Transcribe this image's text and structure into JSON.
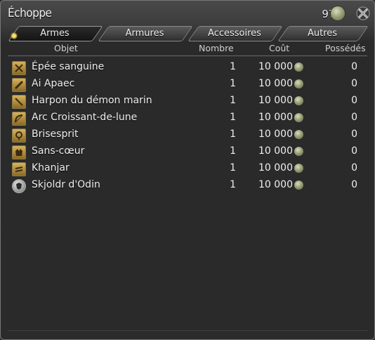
{
  "window": {
    "title": "Échoppe",
    "currency_amount": "970"
  },
  "tabs": [
    {
      "label": "Armes",
      "active": true
    },
    {
      "label": "Armures",
      "active": false
    },
    {
      "label": "Accessoires",
      "active": false
    },
    {
      "label": "Autres",
      "active": false
    }
  ],
  "columns": {
    "item": "Objet",
    "quantity": "Nombre",
    "cost": "Coût",
    "owned": "Possédés"
  },
  "items": [
    {
      "name": "Épée sanguine",
      "quantity": "1",
      "cost": "10 000",
      "owned": "0",
      "icon": "sword-icon"
    },
    {
      "name": "Ai Apaec",
      "quantity": "1",
      "cost": "10 000",
      "owned": "0",
      "icon": "knuckles-icon"
    },
    {
      "name": "Harpon du démon marin",
      "quantity": "1",
      "cost": "10 000",
      "owned": "0",
      "icon": "lance-icon"
    },
    {
      "name": "Arc Croissant-de-lune",
      "quantity": "1",
      "cost": "10 000",
      "owned": "0",
      "icon": "bow-icon"
    },
    {
      "name": "Brisesprit",
      "quantity": "1",
      "cost": "10 000",
      "owned": "0",
      "icon": "staff-icon"
    },
    {
      "name": "Sans-cœur",
      "quantity": "1",
      "cost": "10 000",
      "owned": "0",
      "icon": "grimoire-icon"
    },
    {
      "name": "Khanjar",
      "quantity": "1",
      "cost": "10 000",
      "owned": "0",
      "icon": "daggers-icon"
    },
    {
      "name": "Skjoldr d'Odin",
      "quantity": "1",
      "cost": "10 000",
      "owned": "0",
      "icon": "shield-icon"
    }
  ]
}
